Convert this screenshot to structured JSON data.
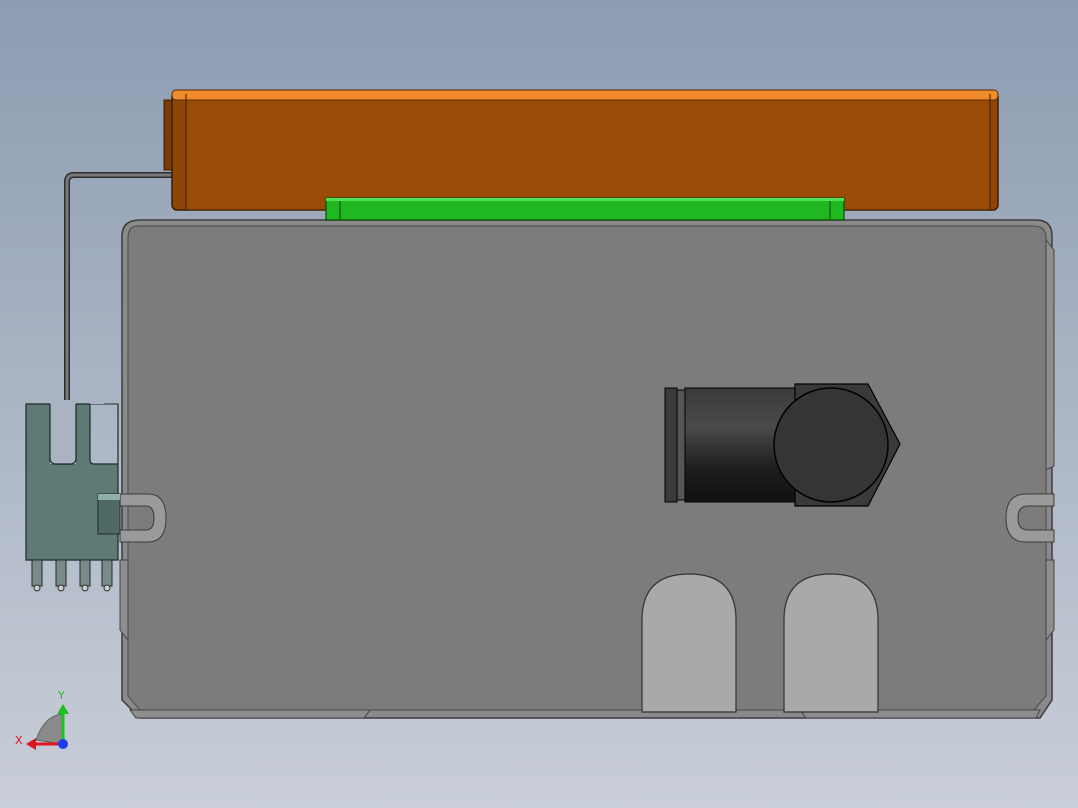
{
  "viewport": {
    "background_top": "#8c9cb1",
    "background_bottom": "#c9ced8"
  },
  "colors": {
    "orange_body": "#9a4c06",
    "orange_edge": "#f08a2a",
    "green_strip": "#1fb820",
    "grey_plate": "#7c7c7c",
    "grey_plate_edge": "#5c5c5c",
    "connector": "#5f7a75",
    "cylinder_dark": "#2f2f2f",
    "slot_light": "#a9a9a9"
  },
  "triad": {
    "x_label": "X",
    "y_label": "Y",
    "x_color": "#e0141e",
    "y_color": "#1ac21a",
    "z_color": "#1e3cf0",
    "icon": "coordinate-triad-icon"
  }
}
